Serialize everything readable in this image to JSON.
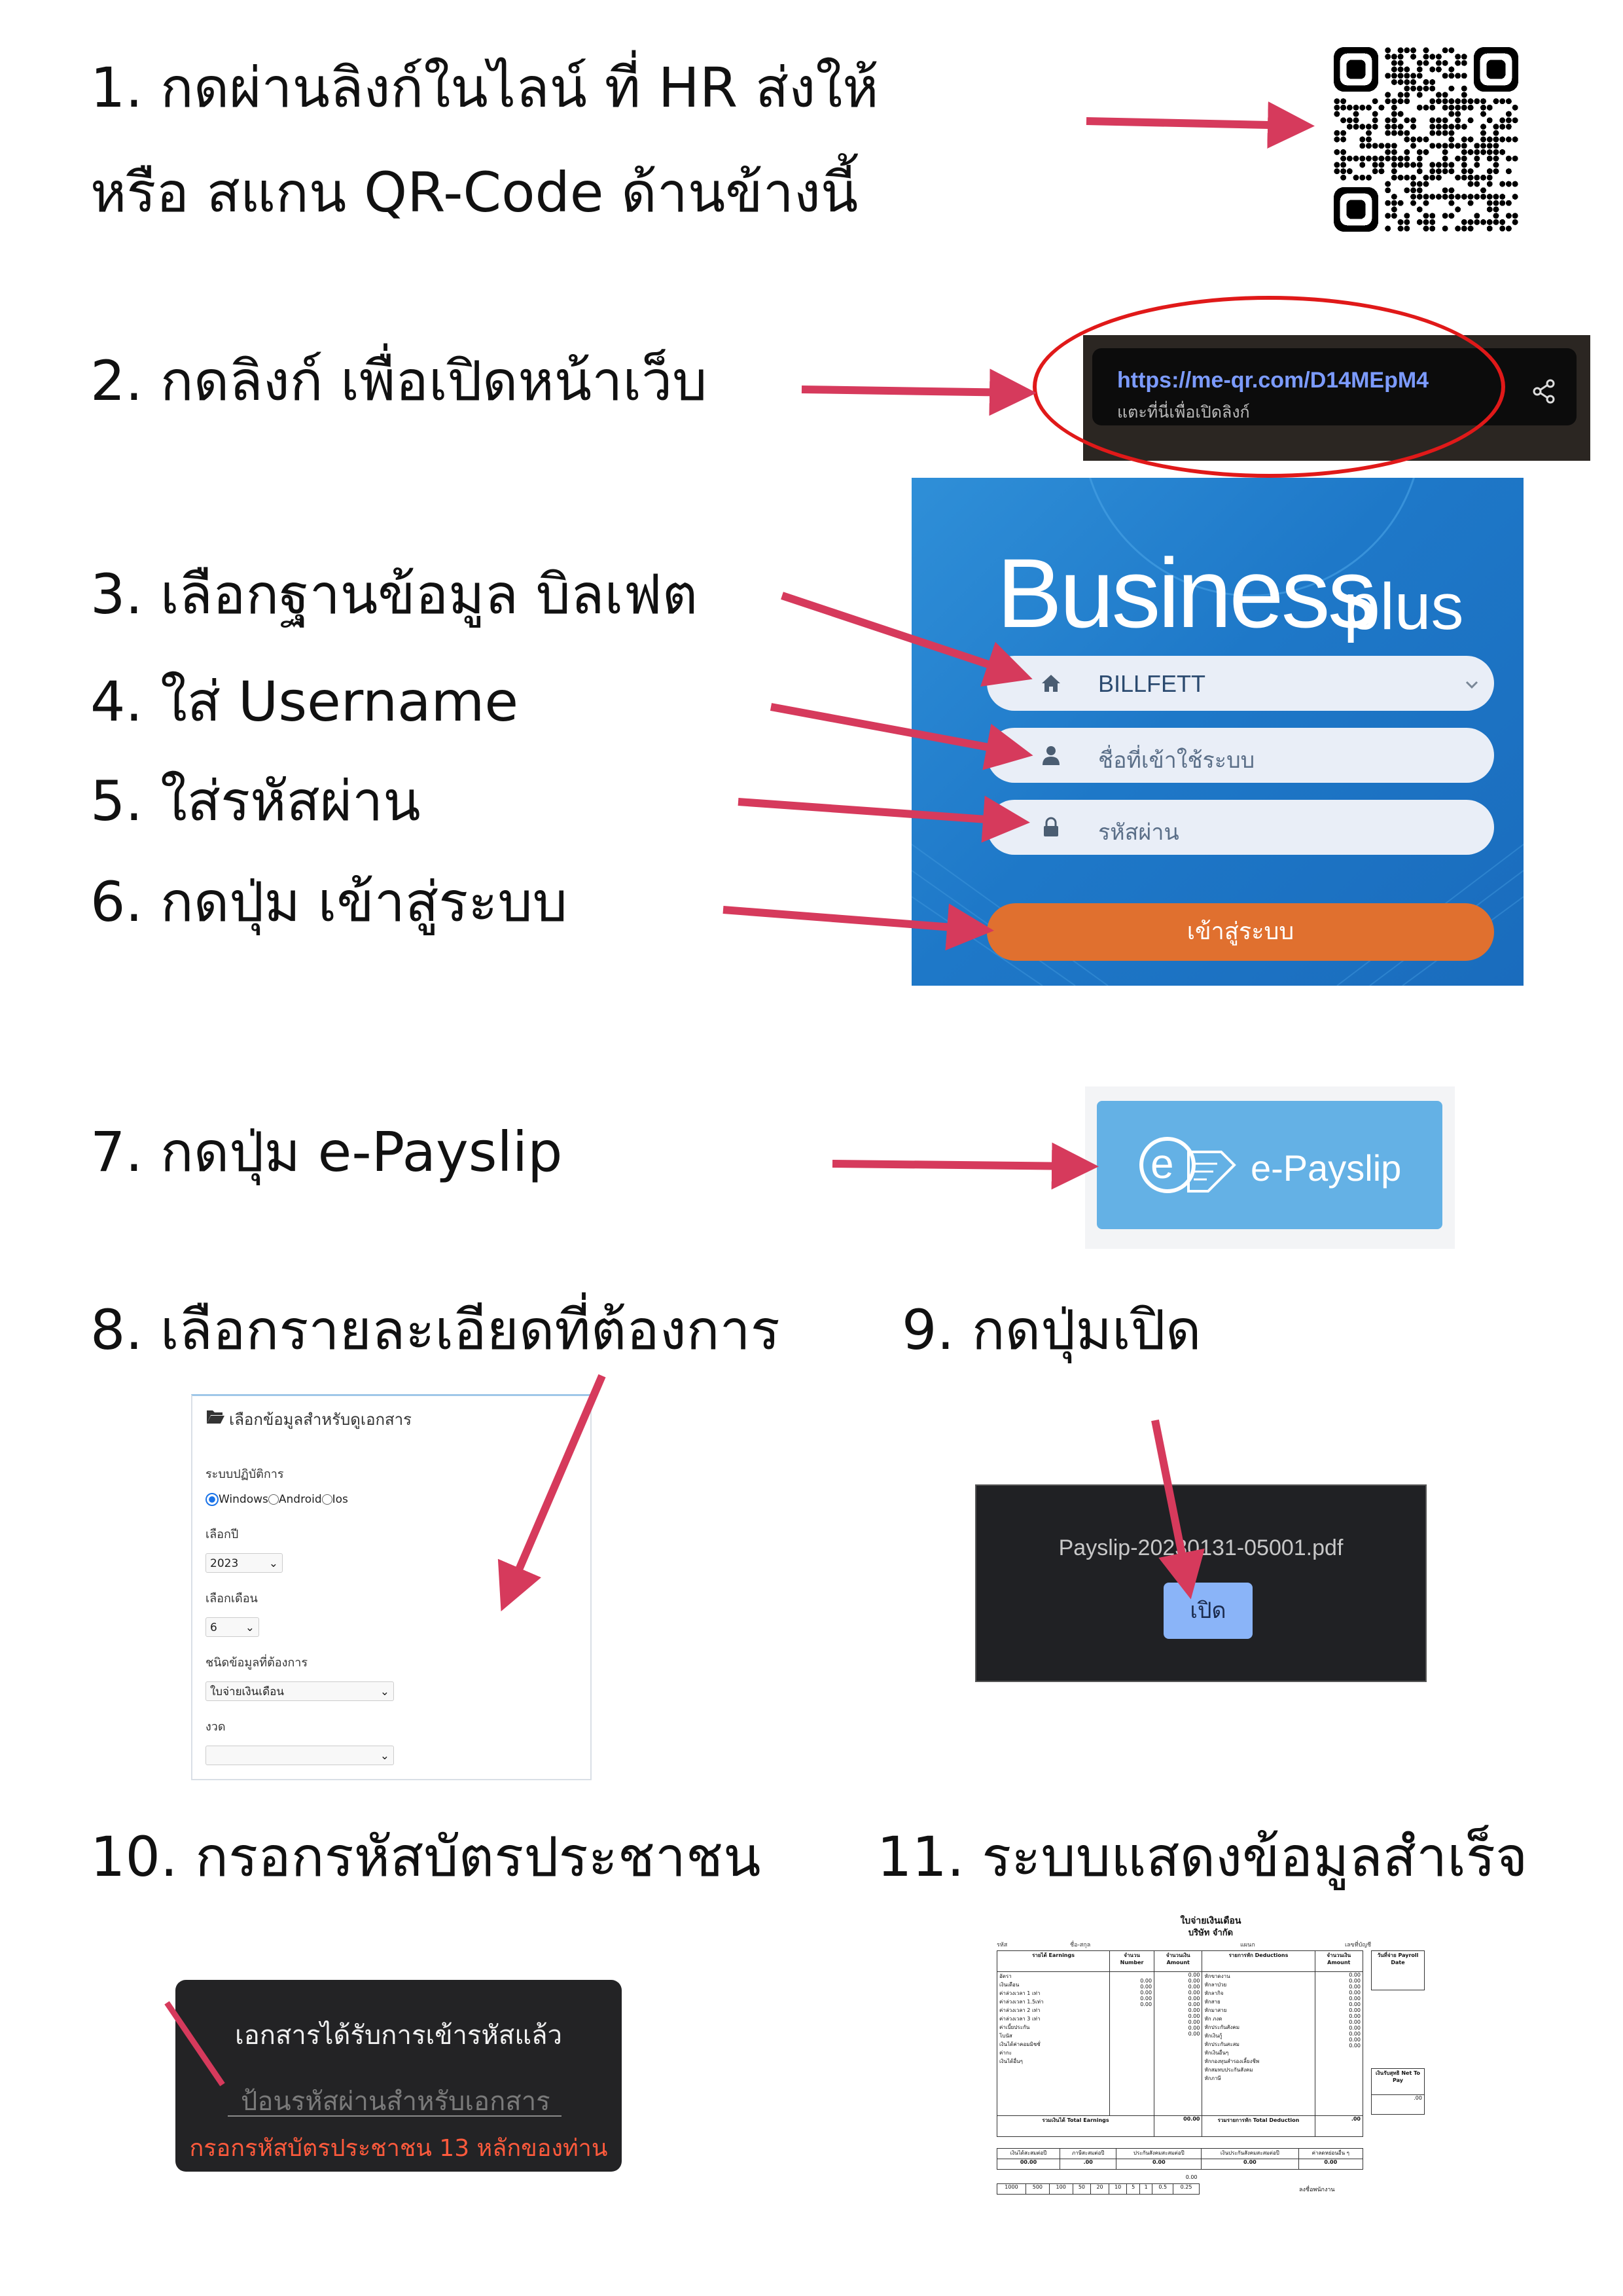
{
  "steps": {
    "s1_line1": "1. กดผ่านลิงก์ในไลน์ ที่ HR ส่งให้",
    "s1_line2": "หรือ สแกน QR-Code ด้านข้างนี้",
    "s2": "2. กดลิงก์ เพื่อเปิดหน้าเว็บ",
    "s3": "3. เลือกฐานข้อมูล บิลเฟต",
    "s4": "4. ใส่ Username",
    "s5": "5. ใส่รหัสผ่าน",
    "s6": "6. กดปุ่ม เข้าสู่ระบบ",
    "s7": "7. กดปุ่ม e-Payslip",
    "s8": "8. เลือกรายละเอียดที่ต้องการ",
    "s9": "9. กดปุ่มเปิด",
    "s10": "10. กรอกรหัสบัตรประชาชน",
    "s11": "11. ระบบแสดงข้อมูลสำเร็จ"
  },
  "link_popup": {
    "url": "https://me-qr.com/D14MEpM4",
    "hint": "แตะที่นี่เพื่อเปิดลิงก์"
  },
  "login": {
    "logo_main": "Business",
    "logo_plus": "plus",
    "database_value": "BILLFETT",
    "username_placeholder": "ชื่อที่เข้าใช้ระบบ",
    "password_placeholder": "รหัสผ่าน",
    "login_button": "เข้าสู่ระบบ"
  },
  "epayslip": {
    "label": "e-Payslip"
  },
  "doc_form": {
    "header": "เลือกข้อมูลสำหรับดูเอกสาร",
    "os_label": "ระบบปฏิบัติการ",
    "os_options": [
      "Windows",
      "Android",
      "Ios"
    ],
    "year_label": "เลือกปี",
    "year_value": "2023",
    "month_label": "เลือกเดือน",
    "month_value": "6",
    "type_label": "ชนิดข้อมูลที่ต้องการ",
    "type_value": "ใบจ่ายเงินเดือน",
    "period_label": "งวด",
    "period_value": ""
  },
  "pdf_dialog": {
    "filename": "Payslip-20230131-05001.pdf",
    "open_button": "เปิด"
  },
  "password_dialog": {
    "title": "เอกสารได้รับการเข้ารหัสแล้ว",
    "placeholder": "ป้อนรหัสผ่านสำหรับเอกสาร",
    "error": "กรอกรหัสบัตรประชาชน 13 หลักของท่าน"
  },
  "payslip": {
    "title": "ใบจ่ายเงินเดือน",
    "company": "บริษัท          จำกัด",
    "meta": [
      "รหัส",
      "ชื่อ-สกุล",
      "แผนก",
      "เลขที่บัญชี"
    ],
    "earn_head": [
      "รายได้ Earnings",
      "จำนวน Number",
      "จำนวนเงิน Amount"
    ],
    "ded_head": [
      "รายการหัก Deductions",
      "จำนวนเงิน Amount"
    ],
    "side_head": "วันที่จ่าย Payroll Date",
    "earnings": [
      "อัตรา",
      "เงินเดือน",
      "ค่าล่วงเวลา 1 เท่า",
      "ค่าล่วงเวลา 1.5เท่า",
      "ค่าล่วงเวลา 2 เท่า",
      "ค่าล่วงเวลา 3 เท่า",
      "ค่าเบี้ยประกัน",
      "โบนัส",
      "เงินได้ค่าคอมมิชชั่",
      "ค่ากะ",
      "เงินได้อื่นๆ"
    ],
    "deductions": [
      "หักขาดงาน",
      "หักลาป่วย",
      "หักลากิจ",
      "หักสาย",
      "หักมาสาย",
      "หัก ภงด",
      "หักประกันสังคม",
      "หักเงินกู้",
      "หักประกันสะสม",
      "หักเงินอื่นๆ",
      "หักกองทุนสำรองเลี้ยงชีพ",
      "หักสมทบประกันสังคม",
      "หักภาษี"
    ],
    "zero": "0.00",
    "total_earn_label": "รวมเงินได้ Total Earnings",
    "total_earn": "00.00",
    "total_ded_label": "รวมรายการหัก Total Deduction",
    "total_ded": ".00",
    "net_label": "เงินรับสุทธิ Net To Pay",
    "net": ".00",
    "ytd_head": [
      "เงินได้สะสมต่อปี",
      "ภาษีสะสมต่อปี",
      "ประกันสังคมสะสมต่อปี",
      "เงินประกันสังคมสะสมต่อปี",
      "ค่าลดหย่อนอื่น ๆ"
    ],
    "ytd_vals": [
      "00.00",
      ".00",
      "0.00",
      "0.00",
      "0.00"
    ],
    "denoms": [
      "1000",
      "500",
      "100",
      "50",
      "20",
      "10",
      "5",
      "1",
      "0.5",
      "0.25"
    ],
    "sign": "ลงชื่อพนักงาน"
  },
  "colors": {
    "arrow": "#d63a5c",
    "ellipse": "#e01919",
    "login_button": "#e0702f",
    "epayslip_button": "#64b1e5"
  }
}
